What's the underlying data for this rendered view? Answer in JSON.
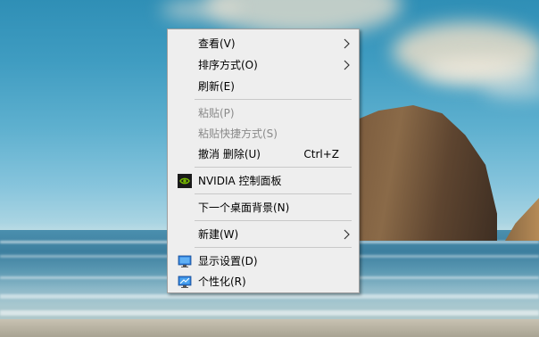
{
  "context_menu": {
    "items": [
      {
        "label": "查看(V)"
      },
      {
        "label": "排序方式(O)"
      },
      {
        "label": "刷新(E)"
      },
      {
        "label": "粘贴(P)"
      },
      {
        "label": "粘贴快捷方式(S)"
      },
      {
        "label": "撤消 删除(U)",
        "shortcut": "Ctrl+Z"
      },
      {
        "label": "NVIDIA 控制面板"
      },
      {
        "label": "下一个桌面背景(N)"
      },
      {
        "label": "新建(W)"
      },
      {
        "label": "显示设置(D)"
      },
      {
        "label": "个性化(R)"
      }
    ],
    "disabled_items": [
      "粘贴(P)",
      "粘贴快捷方式(S)"
    ],
    "submenu_items": [
      "查看(V)",
      "排序方式(O)",
      "新建(W)"
    ],
    "icons": {
      "nvidia": "nvidia-logo-icon",
      "display": "monitor-icon",
      "personalize": "personalize-icon",
      "submenu": "chevron-right-icon"
    }
  },
  "colors": {
    "menu_background": "#eeeeee",
    "menu_border": "#a0a0a0",
    "disabled_text": "#8a8a8a",
    "nvidia_green": "#76b900"
  }
}
